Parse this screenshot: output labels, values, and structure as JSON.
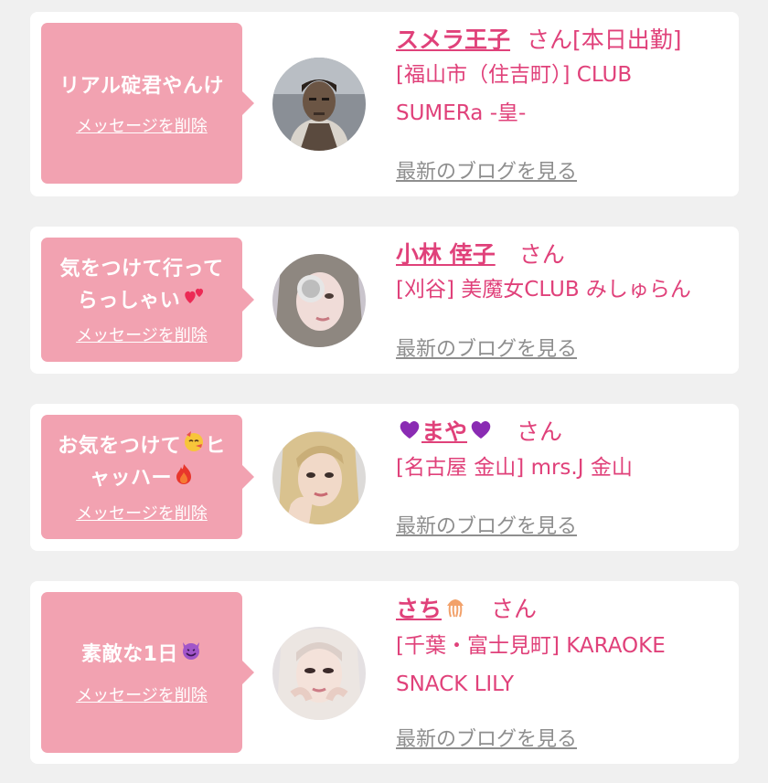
{
  "cards": [
    {
      "message": [
        "リアル碇君やんけ"
      ],
      "delete_label": "メッセージを削除",
      "name": "スメラ王子",
      "honorific": "さん[本日出勤]",
      "shop_lines": [
        "[福山市（住吉町）] CLUB",
        "SUMERa -皇-"
      ],
      "blog_label": "最新のブログを見る"
    },
    {
      "message": [
        "気をつけて行って",
        "らっしゃい"
      ],
      "message_emoji": "two-hearts-icon",
      "delete_label": "メッセージを削除",
      "name": "小林 倖子",
      "honorific": "さん",
      "shop_lines": [
        "[刈谷] 美魔女CLUB みしゅらん"
      ],
      "blog_label": "最新のブログを見る"
    },
    {
      "message": [
        "お気をつけて",
        "ヒ",
        "ャッハー"
      ],
      "message_emoji": [
        "party-face-icon",
        "fire-icon"
      ],
      "delete_label": "メッセージを削除",
      "name": "まや",
      "name_emoji": "purple-heart-icon",
      "honorific": "さん",
      "shop_lines": [
        "[名古屋 金山] mrs.J 金山"
      ],
      "blog_label": "最新のブログを見る"
    },
    {
      "message": [
        "素敵な1日"
      ],
      "message_emoji": "smiling-devil-icon",
      "delete_label": "メッセージを削除",
      "name": "さち",
      "name_emoji": "jellyfish-icon",
      "honorific": "さん",
      "shop_lines": [
        "[千葉・富士見町] KARAOKE",
        "SNACK LILY"
      ],
      "blog_label": "最新のブログを見る"
    }
  ],
  "colors": {
    "background": "#f0f0f0",
    "card": "#ffffff",
    "bubble": "#f2a2b1",
    "accent": "#e0417a",
    "link_gray": "#8e8e8e"
  }
}
